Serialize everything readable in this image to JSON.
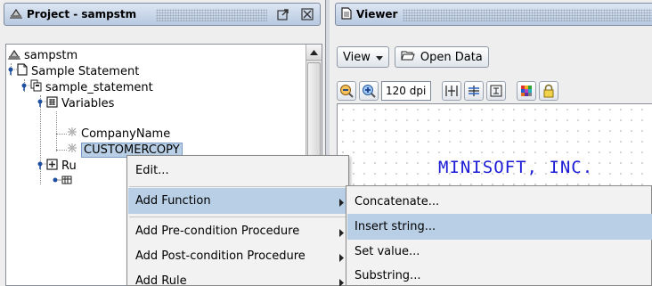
{
  "project_panel": {
    "title": "Project - sampstm"
  },
  "tree": {
    "nodes": [
      {
        "label": "sampstm"
      },
      {
        "label": "Sample Statement"
      },
      {
        "label": "sample_statement"
      },
      {
        "label": "Variables"
      },
      {
        "label": "CompanyName"
      },
      {
        "label": "CUSTOMERCOPY"
      },
      {
        "label": "Ru"
      }
    ]
  },
  "viewer_panel": {
    "title": "Viewer",
    "view_button": "View",
    "open_data_button": "Open Data",
    "dpi_value": "120 dpi",
    "report_text": "MINISOFT, INC."
  },
  "context_menu": {
    "items": [
      {
        "label": "Edit...",
        "has_submenu": false
      },
      {
        "label": "Add Function",
        "has_submenu": true,
        "active": true
      },
      {
        "label": "Add Pre-condition Procedure",
        "has_submenu": true
      },
      {
        "label": "Add Post-condition Procedure",
        "has_submenu": true
      },
      {
        "label": "Add Rule",
        "has_submenu": true
      }
    ]
  },
  "submenu": {
    "items": [
      {
        "label": "Concatenate..."
      },
      {
        "label": "Insert string...",
        "active": true
      },
      {
        "label": "Set value..."
      },
      {
        "label": "Substring..."
      }
    ]
  },
  "colors": {
    "selection": "#b8cfe5",
    "report_text": "#1c1cd6",
    "title_bar": "#c8d6ea"
  }
}
